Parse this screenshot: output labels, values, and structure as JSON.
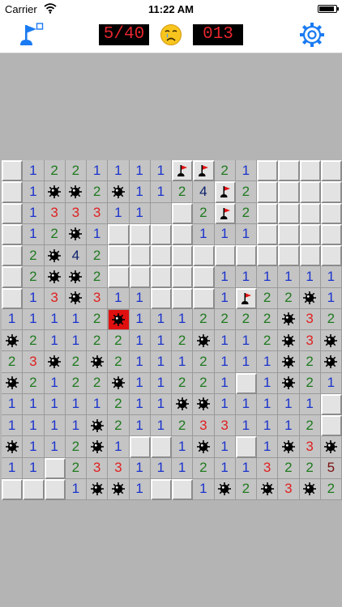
{
  "status_bar": {
    "carrier": "Carrier",
    "time": "11:22 AM",
    "battery_level": 0.92
  },
  "header": {
    "mines_counter": "5/40",
    "time_counter": "013",
    "face": "crying-face-icon",
    "flag_mode_icon": "flag-mode-icon",
    "settings_icon": "gear-icon"
  },
  "colors": {
    "background": "#b4b4b4",
    "number_1": "#1a33cc",
    "number_2": "#1f7a1f",
    "number_3": "#e02020",
    "number_4": "#0b1f6b",
    "number_5": "#7a1010",
    "exploded": "#e01010",
    "counter_text": "#e5262e",
    "accent": "#1a7bf2"
  },
  "board": {
    "cols": 16,
    "rows": 16,
    "legend": {
      ".": "unopened",
      "0": "opened empty",
      "1-8": "adjacent mine count",
      "F": "flag",
      "M": "mine",
      "X": "exploded mine"
    },
    "grid": [
      ".1221111FF21....",
      ".1MM2M1124F2....",
      ".1333110.2F2....",
      ".12M1....111....",
      ".2M42...........",
      ".2MM2.....111111",
      ".13M311...1F22M1",
      "11112X1112222M32",
      "M21122112M112M3M",
      "23M2M21112111M2M",
      "M2122M11221.1M21",
      "11111211MM11111.",
      "1111M2112331112.",
      "M112M1..1M1.1M3M2",
      "11.233111211322532",
      "...1MM1..1M2M3M2"
    ]
  }
}
